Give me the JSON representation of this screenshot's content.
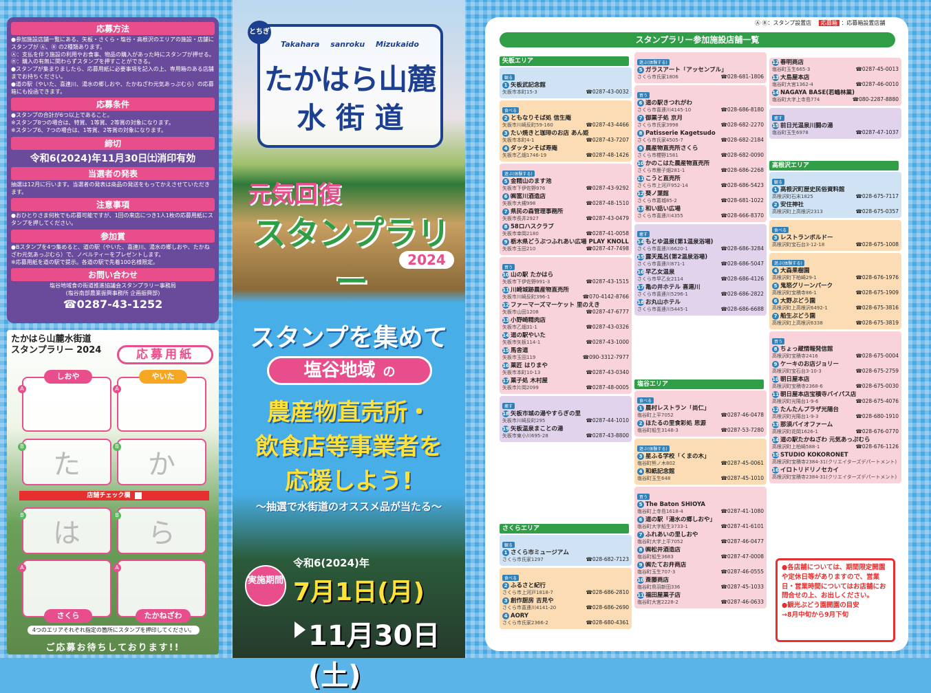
{
  "legend": {
    "text1": "Ⓐ Ⓑ：スタンプ設置店",
    "text2": "応募箱",
    "text3": "：応募箱設置店舗"
  },
  "info": {
    "h_method": "応募方法",
    "method": "●参加施設店舗一覧にある、矢板・さくら・塩谷・高根沢のエリアの施設・店舗にスタンプが Ⓐ、Ⓑ の2種類あります。\nⒶ：支払を伴う施設の利用やお食事、物品の購入があった時にスタンプが押せる。\nⒷ：購入の有無に関わらずスタンプを押すことができる。\n●スタンプが集まりましたら、応募用紙に必要事項を記入の上、専用箱のある店舗までお持ちください。\n●道の駅（やいた、喜連川、湯水の郷しおや、たかねざわ元気あっぷむら）の応募箱にも投函できます。",
    "h_cond": "応募条件",
    "cond": "●スタンプの合計が6つ以上であること。\n※スタンプ8つの場合は、特賞、1等賞、2等賞の対象になります。\n※スタンプ6、7つの場合は、1等賞、2等賞の対象になります。",
    "h_deadline": "締切",
    "deadline": "令和6(2024)年11月30日㈯消印有効",
    "h_announce": "当選者の発表",
    "announce": "抽選は12月に行います。当選者の発表は商品の発送をもってかえさせていただきます。",
    "h_notes": "注意事項",
    "notes": "●おひとりさま何枚でも応募可能ですが、1回の来店につき1人1枚の応募用紙にスタンプを押してください。",
    "h_gift": "参加賞",
    "gift": "●Bスタンプを4つ集めると、道の駅（やいた、喜連川、湯水の郷しおや、たかねざわ元気あっぷむら）で、ノベルティーをプレゼントします。\n※応募用紙を道の駅で提示。各道の駅で先着100名様限定。",
    "h_contact": "お問い合わせ",
    "contact": "塩谷地域食の街道推進協議会スタンプラリー事務局\n(塩谷南部農業振興事務所 企画振興部)",
    "tel": "☎0287-43-1252"
  },
  "form": {
    "title": "たかはら山麓水街道\nスタンプラリー 2024",
    "badge": "応募用紙",
    "boxes": [
      "しおや",
      "やいた",
      "たかねざわ",
      "さくら"
    ],
    "chars": [
      "た",
      "か",
      "は",
      "ら"
    ],
    "check": "店舗チェック欄",
    "bottom_note": "4つのエリアそれぞれ指定の箇所にスタンプを押印してください。",
    "bottom": "ご応募お待ちしております!!"
  },
  "cover": {
    "tochi": "とちぎ",
    "romaji": "Takahara sanroku Mizukaido",
    "title1": "たかはら山麓",
    "title2": "水 街 道",
    "genki": "元気回復",
    "stamp": "スタンプラリー",
    "year": "2024",
    "collect": "スタンプを集めて",
    "region": "塩谷地域",
    "region_no": "の",
    "support1": "農産物直売所・",
    "support2": "飲食店等事業者を",
    "support3": "応援しよう!",
    "lottery": "〜抽選で水街道のオススメ品が当たる〜",
    "period_label": "実施期間",
    "year_era": "令和6(2024)年",
    "start": "7月1日(月)",
    "end": "11月30日(土)"
  },
  "banner": "スタンプラリー参加施設店舗一覧",
  "areas": {
    "yaita": "矢板エリア",
    "sakura": "さくらエリア",
    "shioya": "塩谷エリア",
    "takanezawa": "高根沢エリア"
  },
  "note": "●各店舗については、期間限定開園や定休日等がありますので、営業日・営業時間についてはお店舗にお問合せの上、お出しください。\n●観光ぶどう園開園の目安\n→8月中旬から9月下旬",
  "list": {
    "col1": [
      {
        "tag": "観る",
        "cls": "g-blue",
        "items": [
          [
            "1",
            "矢板武記念館",
            "矢板市本町15-3",
            "☎0287-43-0032"
          ]
        ]
      },
      {
        "tag": "食べる",
        "cls": "g-or",
        "items": [
          [
            "2",
            "ともなりそば処 信生庵",
            "矢板市川崎反町59-160",
            "☎0287-43-4466"
          ],
          [
            "3",
            "たい焼きと珈琲のお店 あん姫",
            "矢板市本町4-1",
            "☎0287-43-7207"
          ],
          [
            "4",
            "ダッタンそば寿庵",
            "矢板市乙畑1746-19",
            "☎0287-48-1426"
          ]
        ]
      },
      {
        "tag": "遊ぶ(体験する)",
        "cls": "g-pk",
        "items": [
          [
            "5",
            "金精山のます池",
            "矢板市下伊佐野976",
            "☎0287-43-9292"
          ],
          [
            "6",
            "㈱富川酒造店",
            "矢板市大槻998",
            "☎0287-48-1510"
          ],
          [
            "7",
            "県民の森管理事務所",
            "矢板市長井2927",
            "☎0287-43-0479"
          ],
          [
            "8",
            "58ロハスクラブ",
            "矢板市幸岡2180",
            "☎0287-41-0058"
          ],
          [
            "9",
            "栃木県どうぶつふれあい広場 PLAY KNOLL",
            "矢板市玉田210",
            "☎0287-47-7498"
          ]
        ]
      },
      {
        "tag": "買う",
        "cls": "g-pk",
        "items": [
          [
            "10",
            "山の駅 たかはら",
            "矢板市下伊佐野991-3",
            "☎0287-43-1515"
          ],
          [
            "11",
            "川崎城跡農産物直売所",
            "矢板市川崎反町396-1",
            "☎070-4142-8766"
          ],
          [
            "12",
            "ファーマーズマーケット 里のえき",
            "矢板市山田1208",
            "☎0287-47-6777"
          ],
          [
            "13",
            "小野崎精肉店",
            "矢板市乙畑31-1",
            "☎0287-43-0326"
          ],
          [
            "14",
            "道の駅やいた",
            "矢板市矢板114-1",
            "☎0287-43-1000"
          ],
          [
            "15",
            "馬舎道",
            "矢板市玉田119",
            "☎090-3312-7977"
          ],
          [
            "16",
            "菓匠 はりまや",
            "矢板市本町10-13",
            "☎0287-43-0340"
          ],
          [
            "17",
            "菓子処 木村屋",
            "矢板市片岡2099",
            "☎0287-48-0005"
          ]
        ]
      },
      {
        "tag": "癒す",
        "cls": "g-pu",
        "items": [
          [
            "18",
            "矢板市城の湯やすらぎの里",
            "矢板市川崎反町295",
            "☎0287-44-1010"
          ],
          [
            "19",
            "矢板温泉まことの湯",
            "矢板市東小川695-28",
            "☎0287-43-8800"
          ]
        ]
      }
    ],
    "sakura": [
      {
        "tag": "観る",
        "cls": "g-blue",
        "items": [
          [
            "1",
            "さくら市ミュージアム",
            "さくら市氏家1297",
            "☎028-682-7123"
          ]
        ]
      },
      {
        "tag": "食べる",
        "cls": "g-or",
        "items": [
          [
            "2",
            "ふるさと紀行",
            "さくら市上河戸1818-7",
            "☎028-686-2810"
          ],
          [
            "3",
            "創作厨房 吉見や",
            "さくら市喜連川4141-20",
            "☎028-686-2690"
          ],
          [
            "4",
            "AORY",
            "さくら市氏家2366-2",
            "☎028-680-4361"
          ]
        ]
      }
    ],
    "col2": [
      {
        "tag": "遊ぶ(体験する)",
        "cls": "g-pk",
        "items": [
          [
            "5",
            "ガラスアート「アッセンブル」",
            "さくら市氏家1806",
            "☎028-681-1806"
          ]
        ]
      },
      {
        "tag": "買う",
        "cls": "g-pk",
        "items": [
          [
            "6",
            "道の駅きつれがわ",
            "さくら市喜連川4145-10",
            "☎028-686-8180"
          ],
          [
            "7",
            "御菓子処 京月",
            "さくら市氏家3998",
            "☎028-682-2270"
          ],
          [
            "8",
            "Patisserie Kagetsudo",
            "さくら市氏家4505-7",
            "☎028-682-2184"
          ],
          [
            "9",
            "農産物直売所さくら",
            "さくら市櫻野1581",
            "☎028-682-0090"
          ],
          [
            "10",
            "かのこはた農産物直売所",
            "さくら市鹿子畑281-1",
            "☎028-686-2268"
          ],
          [
            "11",
            "こうと直売所",
            "さくら市上河戸952-14",
            "☎028-686-5423"
          ],
          [
            "12",
            "葵ノ葉館",
            "さくら市葛城85-2",
            "☎028-681-1022"
          ],
          [
            "13",
            "和い話い広場",
            "さくら市喜連川4355",
            "☎028-666-8370"
          ]
        ]
      },
      {
        "tag": "癒す",
        "cls": "g-pu",
        "items": [
          [
            "14",
            "もとゆ温泉(第1温泉浴場)",
            "さくら市喜連川6620-1",
            "☎028-686-3284"
          ],
          [
            "15",
            "露天風呂(第2温泉浴場)",
            "さくら市喜連川871-1",
            "☎028-686-5047"
          ],
          [
            "16",
            "早乙女温泉",
            "さくら市早乙女2114",
            "☎028-686-4126"
          ],
          [
            "17",
            "亀の井ホテル 喜連川",
            "さくら市喜連川5296-1",
            "☎028-686-2822"
          ],
          [
            "18",
            "お丸山ホテル",
            "さくら市喜連川5445-1",
            "☎028-686-6688"
          ]
        ]
      }
    ],
    "shioya": [
      {
        "tag": "食べる",
        "cls": "g-pk",
        "items": [
          [
            "1",
            "農村レストラン「尚仁」",
            "塩谷町上平7052",
            "☎0287-46-0478"
          ],
          [
            "2",
            "ほたるの里食彩処 思源",
            "塩谷町船生3148-3",
            "☎0287-53-7280"
          ]
        ]
      },
      {
        "tag": "遊ぶ(体験する)",
        "cls": "g-or",
        "items": [
          [
            "3",
            "星ふる学校「くまの木」",
            "塩谷町熊ノ木802",
            "☎0287-45-0061"
          ],
          [
            "4",
            "和紙記念館",
            "塩谷町玉生648",
            "☎0287-45-1010"
          ]
        ]
      },
      {
        "tag": "買う",
        "cls": "g-pk",
        "items": [
          [
            "5",
            "The Baton SHIOYA",
            "塩谷町上寺島1618-4",
            "☎0287-41-1080"
          ],
          [
            "6",
            "道の駅「湯水の郷しおや」",
            "塩谷町大字船生3733-1",
            "☎0287-41-6101"
          ],
          [
            "7",
            "ふれあいの里しおや",
            "塩谷町大字上平7052",
            "☎0287-46-0477"
          ],
          [
            "8",
            "㈱松井酒造店",
            "塩谷町船生3683",
            "☎0287-47-0008"
          ],
          [
            "9",
            "㈱たてお弁商店",
            "塩谷町玉生707-3",
            "☎0287-46-0555"
          ],
          [
            "10",
            "斎藤商店",
            "塩谷町鳥羽新田336",
            "☎0287-45-1033"
          ],
          [
            "11",
            "福田屋菓子店",
            "塩谷町大宮2228-2",
            "☎0287-46-0633"
          ]
        ]
      }
    ],
    "col3": [
      {
        "tag": "",
        "cls": "g-pk",
        "items": [
          [
            "12",
            "春明商店",
            "塩谷町玉生665-3",
            "☎0287-45-0013"
          ],
          [
            "13",
            "大島屋本店",
            "塩谷町大宮1362-4",
            "☎0287-46-0010"
          ],
          [
            "14",
            "NAGAYA BASE(若嶋林業)",
            "塩谷町大字上寺島774",
            "☎080-2287-8880"
          ]
        ]
      },
      {
        "tag": "癒す",
        "cls": "g-pu",
        "items": [
          [
            "15",
            "前日光温泉川闘の湯",
            "塩谷町玉生6978",
            "☎0287-47-1037"
          ]
        ]
      }
    ],
    "taka": [
      {
        "tag": "観る",
        "cls": "g-blue",
        "items": [
          [
            "1",
            "高根沢町歴史民俗資料館",
            "高根沢町石末1825",
            "☎028-675-7117"
          ],
          [
            "2",
            "安住神社",
            "高根沢町上高根沢2313",
            "☎028-675-0357"
          ]
        ]
      },
      {
        "tag": "食べる",
        "cls": "g-or",
        "items": [
          [
            "3",
            "レストランボルドー",
            "高根沢町宝石台3-12-18",
            "☎028-675-1008"
          ]
        ]
      },
      {
        "tag": "遊ぶ(体験する)",
        "cls": "g-or",
        "items": [
          [
            "4",
            "大森果樹園",
            "高根沢町下柏崎29-1",
            "☎028-676-1976"
          ],
          [
            "5",
            "鬼怒グリーンパーク",
            "高根沢町宝積寺86-1",
            "☎028-675-1909"
          ],
          [
            "6",
            "大野ぶどう園",
            "高根沢町上高根沢6492-1",
            "☎028-675-3816"
          ],
          [
            "7",
            "船生ぶどう園",
            "高根沢町上高根沢6338",
            "☎028-675-3819"
          ]
        ]
      },
      {
        "tag": "買う",
        "cls": "g-pk",
        "items": [
          [
            "8",
            "ちょっ蔵情報発信館",
            "高根沢町宝積寺2416",
            "☎028-675-0004"
          ],
          [
            "9",
            "ケーキのお店ジョリー",
            "高根沢町宝石台3-10-3",
            "☎028-675-2759"
          ],
          [
            "10",
            "朝日屋本店",
            "高根沢町宝積寺2368-6",
            "☎028-675-0030"
          ],
          [
            "11",
            "朝日屋本店宝積寺バイパス店",
            "高根沢町光陽台1-9-6",
            "☎028-675-4076"
          ],
          [
            "12",
            "たんたんプラザ光陽台",
            "高根沢町光陽台1-9-3",
            "☎028-680-1910"
          ],
          [
            "13",
            "那須バイオファーム",
            "高根沢町花岡1626-1",
            "☎028-676-0770"
          ],
          [
            "14",
            "道の駅たかねざわ 元気あっぷむら",
            "高根沢町上柏崎588-1",
            "☎028-676-1126"
          ],
          [
            "15",
            "STUDIO KOKORONET",
            "高根沢町宝積寺2384-31(クリエイターズデパートメント)",
            ""
          ],
          [
            "16",
            "イロトリドリノセカイ",
            "高根沢町宝積寺2384-31(クリエイターズデパートメント)",
            ""
          ]
        ]
      }
    ]
  }
}
